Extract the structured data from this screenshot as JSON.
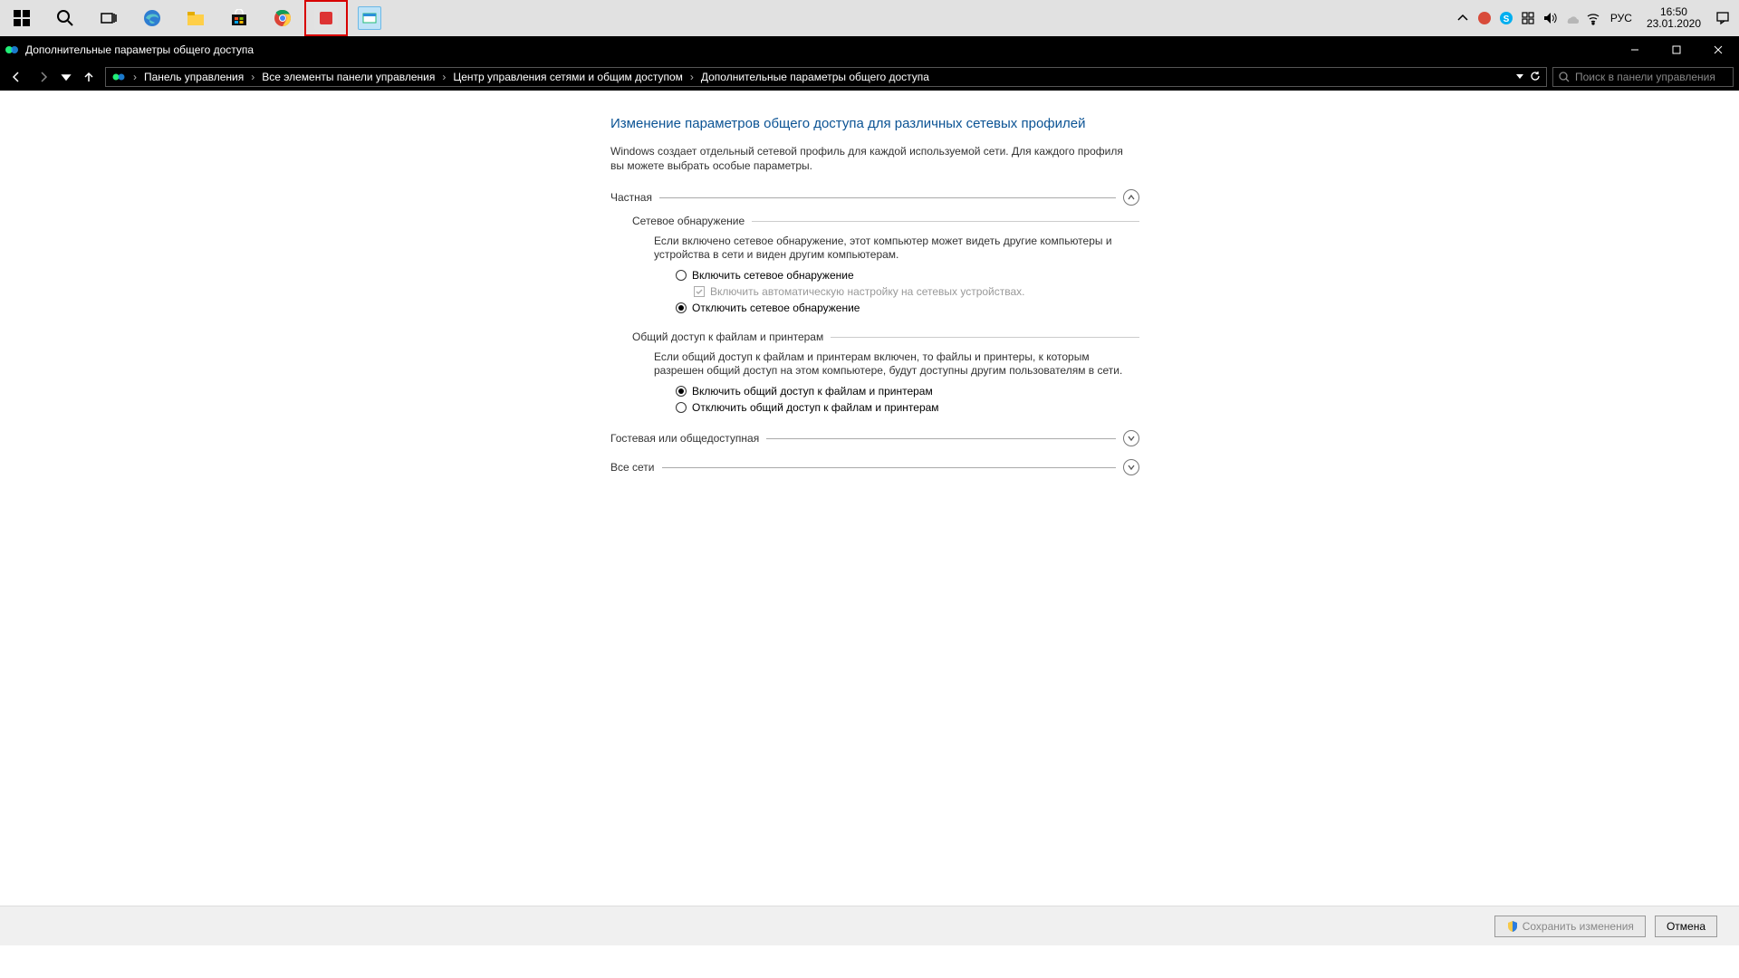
{
  "taskbar": {
    "clock_time": "16:50",
    "clock_date": "23.01.2020",
    "language": "РУС"
  },
  "title": "Дополнительные параметры общего доступа",
  "breadcrumb": {
    "items": [
      "Панель управления",
      "Все элементы панели управления",
      "Центр управления сетями и общим доступом",
      "Дополнительные параметры общего доступа"
    ]
  },
  "search": {
    "placeholder": "Поиск в панели управления"
  },
  "page": {
    "heading": "Изменение параметров общего доступа для различных сетевых профилей",
    "intro": "Windows создает отдельный сетевой профиль для каждой используемой сети. Для каждого профиля вы можете выбрать особые параметры.",
    "profiles": {
      "private": {
        "label": "Частная",
        "discovery": {
          "label": "Сетевое обнаружение",
          "desc": "Если включено сетевое обнаружение, этот компьютер может видеть другие компьютеры и устройства в сети и виден другим компьютерам.",
          "opt_on": "Включить сетевое обнаружение",
          "opt_auto": "Включить автоматическую настройку на сетевых устройствах.",
          "opt_off": "Отключить сетевое обнаружение"
        },
        "fileshare": {
          "label": "Общий доступ к файлам и принтерам",
          "desc": "Если общий доступ к файлам и принтерам включен, то файлы и принтеры, к которым разрешен общий доступ на этом компьютере, будут доступны другим пользователям в сети.",
          "opt_on": "Включить общий доступ к файлам и принтерам",
          "opt_off": "Отключить общий доступ к файлам и принтерам"
        }
      },
      "guest": {
        "label": "Гостевая или общедоступная"
      },
      "all": {
        "label": "Все сети"
      }
    }
  },
  "footer": {
    "save": "Сохранить изменения",
    "cancel": "Отмена"
  }
}
